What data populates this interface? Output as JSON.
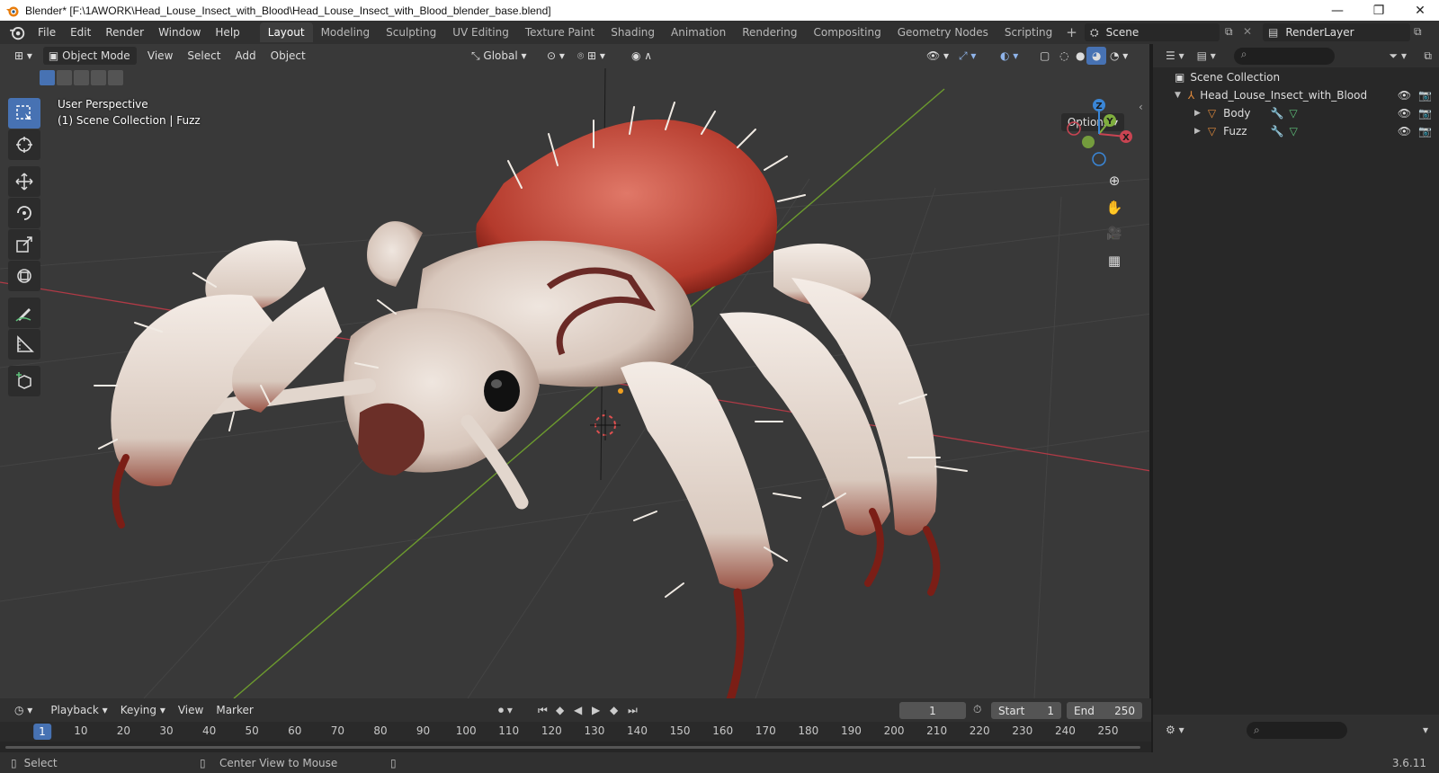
{
  "window": {
    "title": "Blender* [F:\\1AWORK\\Head_Louse_Insect_with_Blood\\Head_Louse_Insect_with_Blood_blender_base.blend]",
    "minimize": "—",
    "maximize": "❐",
    "close": "✕"
  },
  "menu": {
    "items": [
      "File",
      "Edit",
      "Render",
      "Window",
      "Help"
    ]
  },
  "workspaces": {
    "tabs": [
      "Layout",
      "Modeling",
      "Sculpting",
      "UV Editing",
      "Texture Paint",
      "Shading",
      "Animation",
      "Rendering",
      "Compositing",
      "Geometry Nodes",
      "Scripting"
    ],
    "active": "Layout",
    "add": "+"
  },
  "scene": {
    "name": "Scene",
    "view_layer": "RenderLayer"
  },
  "viewport": {
    "mode": "Object Mode",
    "menus": [
      "View",
      "Select",
      "Add",
      "Object"
    ],
    "orientation": "Global",
    "info_line1": "User Perspective",
    "info_line2": "(1) Scene Collection | Fuzz",
    "options": "Options",
    "gizmo": {
      "x": "X",
      "y": "Y",
      "z": "Z"
    }
  },
  "outliner": {
    "root": "Scene Collection",
    "collection": "Head_Louse_Insect_with_Blood",
    "objects": [
      "Body",
      "Fuzz"
    ]
  },
  "timeline": {
    "menus": [
      "Playback",
      "Keying",
      "View",
      "Marker"
    ],
    "current_frame": "1",
    "start_label": "Start",
    "start": "1",
    "end_label": "End",
    "end": "250",
    "ticks": [
      "10",
      "20",
      "30",
      "40",
      "50",
      "60",
      "70",
      "80",
      "90",
      "100",
      "110",
      "120",
      "130",
      "140",
      "150",
      "160",
      "170",
      "180",
      "190",
      "200",
      "210",
      "220",
      "230",
      "240",
      "250"
    ]
  },
  "status": {
    "select": "Select",
    "center": "Center View to Mouse",
    "version": "3.6.11"
  },
  "colors": {
    "accent": "#4772b3",
    "x_axis": "#e0414e",
    "y_axis": "#8cc43f",
    "z_axis": "#3a86d6"
  }
}
